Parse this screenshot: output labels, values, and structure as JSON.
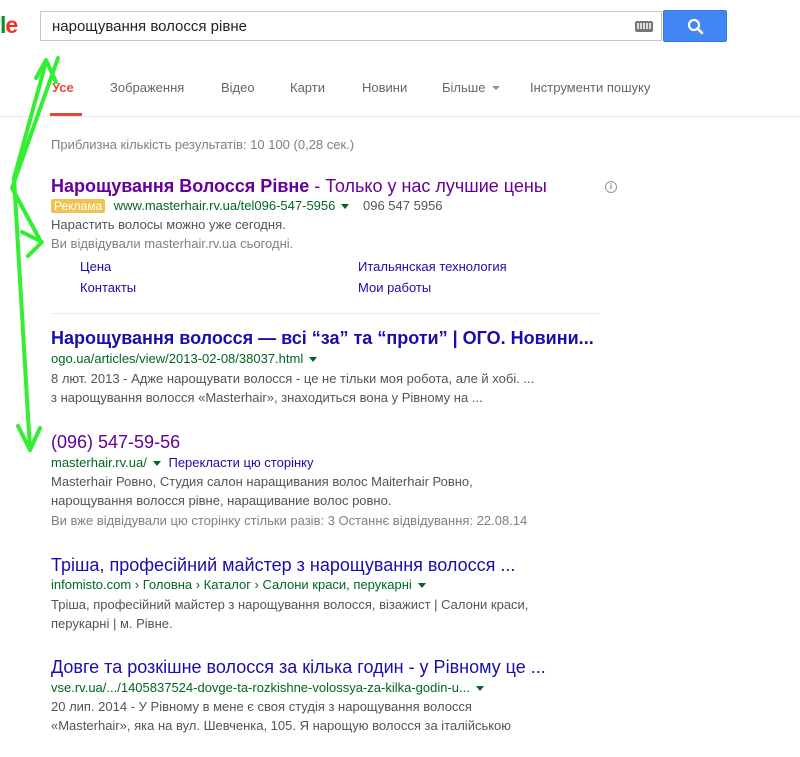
{
  "header": {
    "search_query": "нарощування волосся рівне"
  },
  "tabs": [
    {
      "label": "Усе"
    },
    {
      "label": "Зображення"
    },
    {
      "label": "Відео"
    },
    {
      "label": "Карти"
    },
    {
      "label": "Новини"
    },
    {
      "label": "Більше"
    },
    {
      "label": "Інструменти пошуку"
    }
  ],
  "stats": "Приблизна кількість результатів: 10 100 (0,28 сек.)",
  "ad": {
    "title_bold": "Нарощування Волосся Рівне",
    "title_rest": " - Только у нас лучшие цены",
    "badge": "Реклама",
    "url": "www.masterhair.rv.ua/tel096-547-5956",
    "phone": "096 547 5956",
    "snippet": "Нарастить волосы можно уже сегодня.",
    "visited_note": "Ви відвідували masterhair.rv.ua сьогодні.",
    "sitelinks": [
      "Цена",
      "Итальянская технология",
      "Контакты",
      "Мои работы"
    ]
  },
  "results": [
    {
      "title": "Нарощування волосся — всі “за” та “проти” | ОГО. Новини...",
      "url": "ogo.ua/articles/view/2013-02-08/38037.html",
      "snippet1": "8 лют. 2013 - Адже нарощувати волосся - це не тільки моя робота, але й хобі. ...",
      "snippet2": "з нарощування волосся «Masterhair», знаходиться вона у Рівному на ..."
    },
    {
      "title": "(096) 547-59-56",
      "url": "masterhair.rv.ua/",
      "translate": "Перекласти цю сторінку",
      "snippet1": "Masterhair Ровно, Студия салон наращивания волос Maiterhair Ровно,",
      "snippet2": "нарощування волосся рівне, наращивание волос ровно.",
      "snippet3": "Ви вже відвідували цю сторінку стільки разів: 3 Останнє відвідування: 22.08.14"
    },
    {
      "title": "Тріша, професійний майстер з нарощування волосся ...",
      "url": "infomisto.com › Головна › Каталог › Салони краси, перукарні",
      "snippet1": "Тріша, професійний майстер з нарощування волосся, візажист | Салони краси,",
      "snippet2": "перукарні | м. Рівне."
    },
    {
      "title": "Довге та розкішне волосся за кілька годин - у Рівному це ...",
      "url": "vse.rv.ua/.../1405837524-dovge-ta-rozkishne-volossya-za-kilka-godin-u...",
      "snippet1": "20 лип. 2014 - У Рівному в мене є своя студія з нарощування волосся",
      "snippet2": "«Masterhair», яка на вул. Шевченка, 105. Я нарощую волосся за італійською"
    }
  ],
  "colors": {
    "link": "#1a0dab",
    "visited": "#660099",
    "url": "#006621",
    "accent": "#dd4b39",
    "button": "#4285f4",
    "annotation_arrows": "#33ee33"
  }
}
